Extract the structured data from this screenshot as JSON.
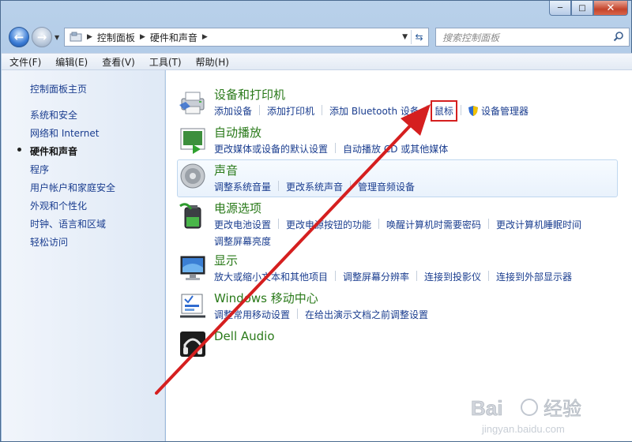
{
  "window": {
    "caption_buttons": {
      "minimize": "─",
      "maximize": "□",
      "close": "✕"
    }
  },
  "address": {
    "breadcrumbs": [
      "控制面板",
      "硬件和声音"
    ],
    "search_placeholder": "搜索控制面板"
  },
  "menu": [
    "文件(F)",
    "编辑(E)",
    "查看(V)",
    "工具(T)",
    "帮助(H)"
  ],
  "sidebar": {
    "home": "控制面板主页",
    "items": [
      "系统和安全",
      "网络和 Internet",
      "硬件和声音",
      "程序",
      "用户帐户和家庭安全",
      "外观和个性化",
      "时钟、语言和区域",
      "轻松访问"
    ],
    "current_index": 2
  },
  "categories": [
    {
      "title": "设备和打印机",
      "icon": "printer-icon",
      "links": [
        "添加设备",
        "添加打印机",
        "添加 Bluetooth 设备",
        "鼠标",
        "设备管理器"
      ]
    },
    {
      "title": "自动播放",
      "icon": "autoplay-icon",
      "links": [
        "更改媒体或设备的默认设置",
        "自动播放 CD 或其他媒体"
      ]
    },
    {
      "title": "声音",
      "icon": "speaker-icon",
      "links": [
        "调整系统音量",
        "更改系统声音",
        "管理音频设备"
      ]
    },
    {
      "title": "电源选项",
      "icon": "battery-icon",
      "links": [
        "更改电池设置",
        "更改电源按钮的功能",
        "唤醒计算机时需要密码",
        "更改计算机睡眠时间",
        "调整屏幕亮度"
      ]
    },
    {
      "title": "显示",
      "icon": "monitor-icon",
      "links": [
        "放大或缩小文本和其他项目",
        "调整屏幕分辨率",
        "连接到投影仪",
        "连接到外部显示器"
      ]
    },
    {
      "title": "Windows 移动中心",
      "icon": "mobility-center-icon",
      "links": [
        "调整常用移动设置",
        "在给出演示文档之前调整设置"
      ]
    },
    {
      "title": "Dell Audio",
      "icon": "headphones-icon",
      "links": []
    }
  ],
  "highlighted_link": "鼠标",
  "colors": {
    "category_title": "#2a7a1a",
    "link": "#1a3d8f",
    "annotation": "#d51f1f"
  },
  "watermark": {
    "brand": "Bai",
    "brand2": "经验",
    "url": "jingyan.baidu.com"
  }
}
